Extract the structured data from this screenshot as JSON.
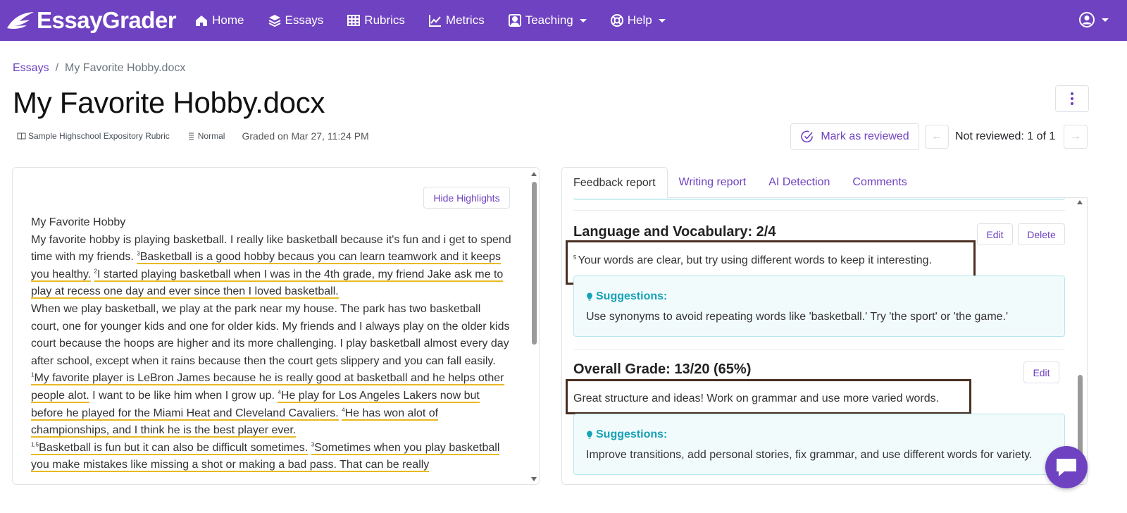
{
  "brand": {
    "name": "EssayGrader"
  },
  "nav": {
    "home": "Home",
    "essays": "Essays",
    "rubrics": "Rubrics",
    "metrics": "Metrics",
    "teaching": "Teaching",
    "help": "Help"
  },
  "breadcrumb": {
    "parent": "Essays",
    "separator": "/",
    "current": "My Favorite Hobby.docx"
  },
  "page": {
    "title": "My Favorite Hobby.docx",
    "rubric": "Sample Highschool Expository Rubric",
    "mode": "Normal",
    "graded": "Graded on Mar 27, 11:24 PM"
  },
  "review": {
    "button": "Mark as reviewed",
    "prev": "←",
    "next": "→",
    "status": "Not reviewed: 1 of 1"
  },
  "essay": {
    "hide_button": "Hide Highlights",
    "title": "My Favorite Hobby",
    "p1_a": "My favorite hobby is playing basketball. I really like basketball because it's fun and i get to spend time with my friends. ",
    "p1_sup1": "3",
    "p1_hl1": "Basketball is a good hobby becaus you can learn teamwork and it keeps you healthy.",
    "p1_sup2": "2",
    "p1_hl2": "I started playing basketball when I was in the 4th grade, my friend Jake ask me to play at recess one day and ever since then I loved basketball.",
    "p2": "When we play basketball, we play at the park near my house. The park has two basketball court, one for younger kids and one for older kids. My friends and I always play on the older kids court because the hoops are higher and its more challenging. I play basketball almost every day after school, except when it rains because then the court gets slippery and you can fall easily.",
    "p3_sup1": "1",
    "p3_hl1": "My favorite player is LeBron James because he is really good at basketball and he helps other people alot.",
    "p3_mid": " I want to be like him when I grow up. ",
    "p3_sup2": "4",
    "p3_hl2": "He play for Los Angeles Lakers now but before he played for the Miami Heat and Cleveland Cavaliers.",
    "p3_sup3": "4",
    "p3_hl3": "He has won alot of championships, and I think he is the best player ever.",
    "p4_sup1": "1,5",
    "p4_hl1": "Basketball is fun but it can also be difficult sometimes.",
    "p4_sup2": "3",
    "p4_hl2": "Sometimes when you play basketball you make mistakes like missing a shot or making a bad pass. That can be really"
  },
  "tabs": {
    "feedback": "Feedback report",
    "writing": "Writing report",
    "ai": "AI Detection",
    "comments": "Comments"
  },
  "feedback": {
    "language": {
      "title": "Language and Vocabulary: 2/4",
      "edit": "Edit",
      "delete": "Delete",
      "sup": "5",
      "comment": "Your words are clear, but try using different words to keep it interesting.",
      "suggest_label": "Suggestions:",
      "suggest_text": "Use synonyms to avoid repeating words like 'basketball.' Try 'the sport' or 'the game.'"
    },
    "overall": {
      "title": "Overall Grade: 13/20 (65%)",
      "edit": "Edit",
      "comment": "Great structure and ideas! Work on grammar and use more varied words.",
      "suggest_label": "Suggestions:",
      "suggest_text": "Improve transitions, add personal stories, fix grammar, and use different words for variety."
    }
  },
  "colors": {
    "brand": "#6f42c1",
    "highlight": "#e8b923",
    "suggest": "#17a2b8",
    "annotation": "#4a2f22"
  }
}
